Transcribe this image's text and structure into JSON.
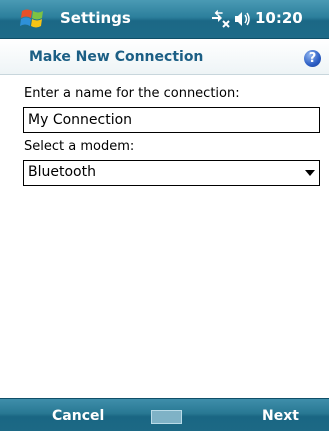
{
  "titlebar": {
    "app_title": "Settings",
    "time": "10:20",
    "icons": [
      "windows-start-icon",
      "connectivity-icon",
      "volume-icon"
    ]
  },
  "header": {
    "title": "Make New Connection",
    "help_icon": "?"
  },
  "form": {
    "name_label": "Enter a name for the connection:",
    "name_value": "My Connection",
    "modem_label": "Select a modem:",
    "modem_value": "Bluetooth"
  },
  "softkeys": {
    "left": "Cancel",
    "right": "Next",
    "center_icon": "keyboard-icon"
  },
  "colors": {
    "titlebar": "#2c7f9c",
    "header_text": "#1c5f85",
    "help_icon": "#2c5ec4"
  }
}
